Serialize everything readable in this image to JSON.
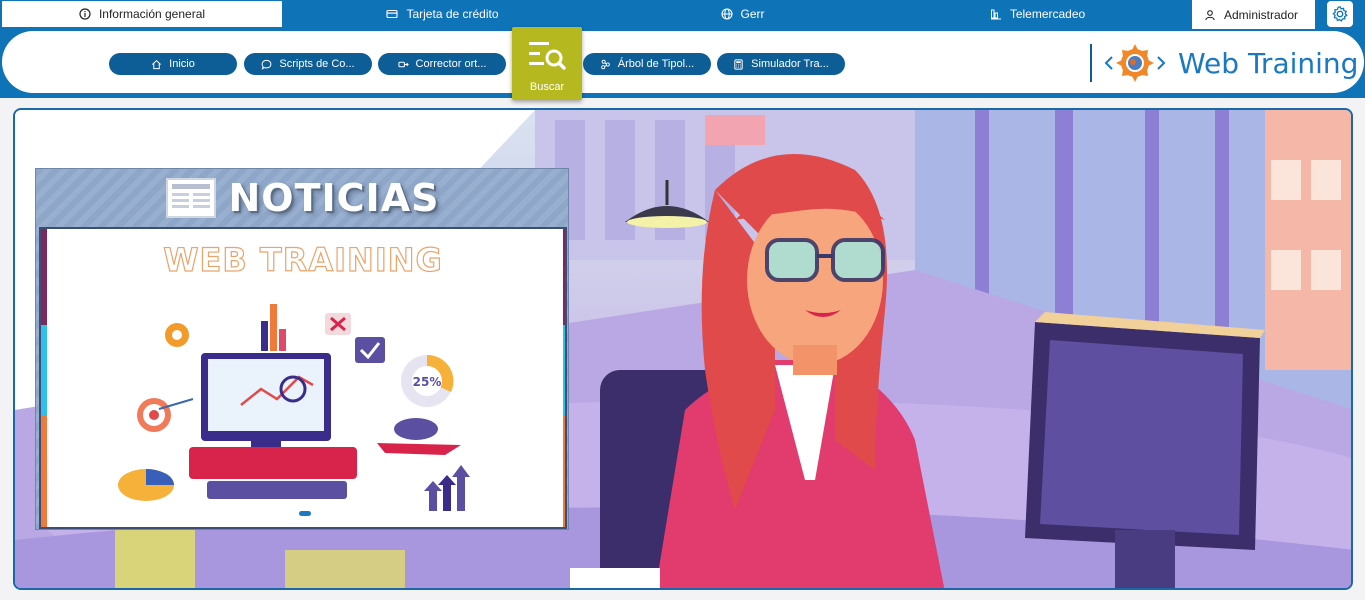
{
  "top_tabs": [
    {
      "label": "Información general",
      "icon": "info-icon"
    },
    {
      "label": "Tarjeta de crédito",
      "icon": "credit-card-icon"
    },
    {
      "label": "Gerr",
      "icon": "globe-icon"
    },
    {
      "label": "Telemercadeo",
      "icon": "chart-icon"
    }
  ],
  "user": {
    "label": "Administrador",
    "icon": "user-icon"
  },
  "settings": {
    "icon": "gear-icon"
  },
  "nav": {
    "items": [
      {
        "label": "Inicio",
        "icon": "home-icon"
      },
      {
        "label": "Scripts de Co...",
        "icon": "chat-icon"
      },
      {
        "label": "Corrector ort...",
        "icon": "spellcheck-icon"
      },
      {
        "label": "Árbol de Tipol...",
        "icon": "tree-icon"
      },
      {
        "label": "Simulador Tra...",
        "icon": "calculator-icon"
      }
    ],
    "search": {
      "label": "Buscar",
      "icon": "search-list-icon",
      "color": "#b5b81f"
    }
  },
  "brand": {
    "name": "Web Training",
    "color": "#1a79c2"
  },
  "news": {
    "title": "NOTICIAS",
    "slide_title": "WEB TRAINING",
    "badge": "25%"
  },
  "colors": {
    "primary": "#0f73b8",
    "nav_pill": "#0d5e96"
  }
}
